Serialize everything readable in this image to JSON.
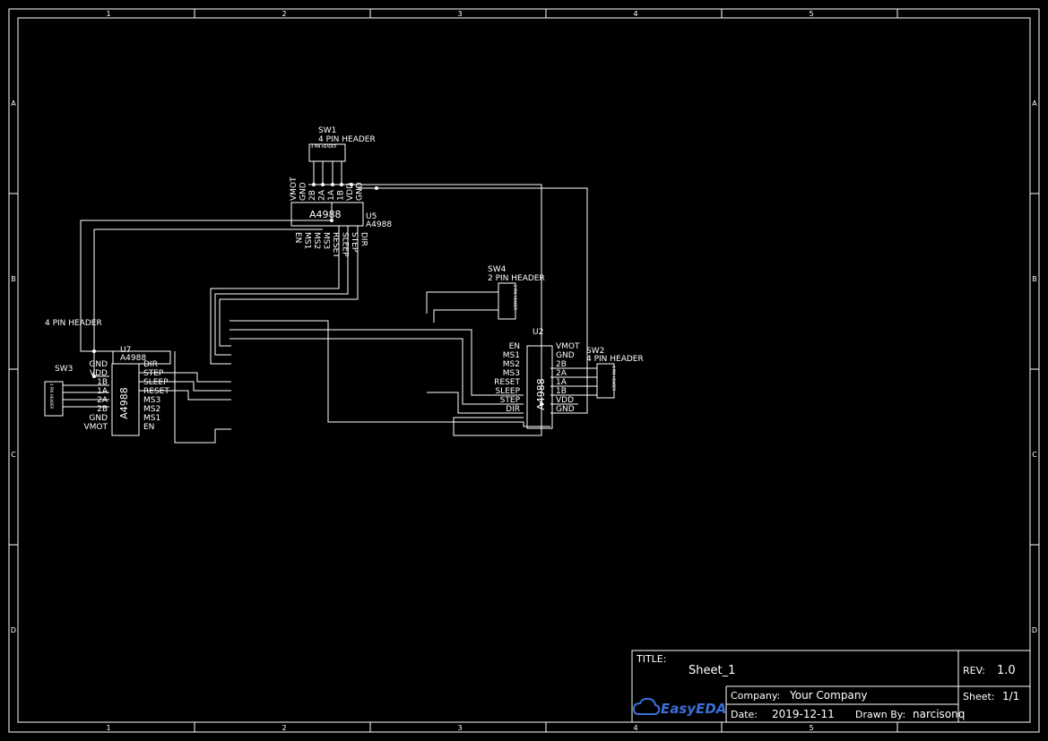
{
  "frame": {
    "cols": [
      "1",
      "2",
      "3",
      "4",
      "5"
    ],
    "rows": [
      "A",
      "B",
      "C",
      "D"
    ]
  },
  "title_block": {
    "title_label": "TITLE:",
    "title": "Sheet_1",
    "rev_label": "REV:",
    "rev": "1.0",
    "company_label": "Company:",
    "company": "Your Company",
    "sheet_label": "Sheet:",
    "sheet": "1/1",
    "date_label": "Date:",
    "date": "2019-12-11",
    "drawn_label": "Drawn By:",
    "drawn_by": "narcisonq",
    "logo_text": "EasyEDA",
    "logo_color": "#3a6fd8"
  },
  "components": {
    "sw1": {
      "ref": "SW1",
      "value": "4 PIN HEADER",
      "body": "4 PIN HEADER"
    },
    "u5": {
      "ref": "U5",
      "value": "A4988",
      "body": "A4988",
      "top_pins": [
        "VMOT",
        "GND",
        "2B",
        "2A",
        "1A",
        "1B",
        "VDD",
        "GND"
      ],
      "bottom_pins": [
        "EN",
        "MS1",
        "MS2",
        "MS3",
        "RESET",
        "SLEEP",
        "STEP",
        "DIR"
      ]
    },
    "sw4": {
      "ref": "SW4",
      "value": "2 PIN HEADER",
      "body": "2 PIN HEADER"
    },
    "u2": {
      "ref": "U2",
      "body": "A4988",
      "left_pins": [
        "EN",
        "MS1",
        "MS2",
        "MS3",
        "RESET",
        "SLEEP",
        "STEP",
        "DIR"
      ],
      "right_pins": [
        "VMOT",
        "GND",
        "2B",
        "2A",
        "1A",
        "1B",
        "VDD",
        "GND"
      ]
    },
    "sw2": {
      "ref": "SW2",
      "value": "4 PIN HEADER",
      "body": "4 PIN HEADER"
    },
    "u7": {
      "ref": "U7",
      "value": "A4988",
      "body": "A4988",
      "left_pins": [
        "GND",
        "VDD",
        "1B",
        "1A",
        "2A",
        "2B",
        "GND",
        "VMOT"
      ],
      "right_pins": [
        "DIR",
        "STEP",
        "SLEEP",
        "RESET",
        "MS3",
        "MS2",
        "MS1",
        "EN"
      ]
    },
    "sw3": {
      "ref": "SW3",
      "value": "4 PIN HEADER",
      "body": "4 PIN HEADER"
    }
  }
}
